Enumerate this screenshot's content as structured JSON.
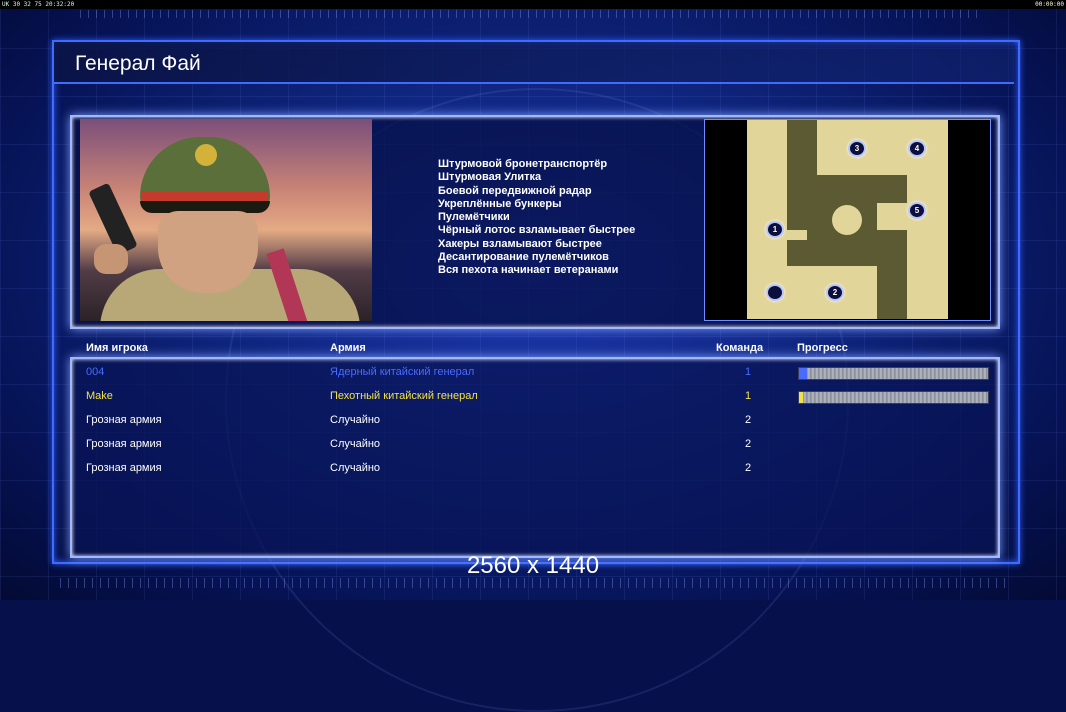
{
  "topbar": {
    "left": "UK 30 32 75 20:32:20",
    "right": "00:00:00"
  },
  "title": "Генерал Фай",
  "features": [
    "Штурмовой бронетранспортёр",
    "Штурмовая Улитка",
    "Боевой передвижной радар",
    "Укреплённые бункеры",
    "Пулемётчики",
    "Чёрный лотос взламывает быстрее",
    "Хакеры взламывают быстрее",
    "Десантирование пулемётчиков",
    "Вся пехота начинает ветеранами"
  ],
  "minimap": {
    "spots": [
      {
        "label": "3"
      },
      {
        "label": "4"
      },
      {
        "label": "1"
      },
      {
        "label": "5"
      },
      {
        "label": ""
      },
      {
        "label": "2"
      }
    ]
  },
  "table": {
    "headers": {
      "player": "Имя игрока",
      "army": "Армия",
      "team": "Команда",
      "progress": "Прогресс"
    },
    "rows": [
      {
        "player": "004",
        "army": "Ядерный китайский генерал",
        "team": "1",
        "color": "#4a6bff",
        "progress": 0.04
      },
      {
        "player": "Make",
        "army": "Пехотный китайский генерал",
        "team": "1",
        "color": "#f2e14a",
        "progress": 0.02
      },
      {
        "player": "Грозная армия",
        "army": "Случайно",
        "team": "2",
        "color": "#ffffff"
      },
      {
        "player": "Грозная армия",
        "army": "Случайно",
        "team": "2",
        "color": "#ffffff"
      },
      {
        "player": "Грозная армия",
        "army": "Случайно",
        "team": "2",
        "color": "#ffffff"
      }
    ]
  },
  "resolution": "2560 x 1440"
}
